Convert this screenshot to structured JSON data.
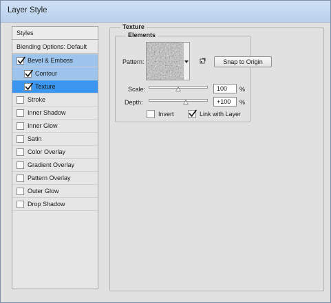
{
  "window": {
    "title": "Layer Style"
  },
  "styles_panel": {
    "header": "Styles",
    "blending_options": "Blending Options: Default",
    "items": [
      {
        "label": "Bevel & Emboss",
        "checked": true,
        "indent": false,
        "selected": "light"
      },
      {
        "label": "Contour",
        "checked": true,
        "indent": true,
        "selected": "light"
      },
      {
        "label": "Texture",
        "checked": true,
        "indent": true,
        "selected": "strong"
      },
      {
        "label": "Stroke",
        "checked": false,
        "indent": false,
        "selected": "none"
      },
      {
        "label": "Inner Shadow",
        "checked": false,
        "indent": false,
        "selected": "none"
      },
      {
        "label": "Inner Glow",
        "checked": false,
        "indent": false,
        "selected": "none"
      },
      {
        "label": "Satin",
        "checked": false,
        "indent": false,
        "selected": "none"
      },
      {
        "label": "Color Overlay",
        "checked": false,
        "indent": false,
        "selected": "none"
      },
      {
        "label": "Gradient Overlay",
        "checked": false,
        "indent": false,
        "selected": "none"
      },
      {
        "label": "Pattern Overlay",
        "checked": false,
        "indent": false,
        "selected": "none"
      },
      {
        "label": "Outer Glow",
        "checked": false,
        "indent": false,
        "selected": "none"
      },
      {
        "label": "Drop Shadow",
        "checked": false,
        "indent": false,
        "selected": "none"
      }
    ]
  },
  "texture": {
    "section_title": "Texture",
    "elements_title": "Elements",
    "pattern_label": "Pattern:",
    "snap_button": "Snap to Origin",
    "scale_label": "Scale:",
    "scale_value": "100",
    "scale_percent": 100,
    "depth_label": "Depth:",
    "depth_value": "+100",
    "depth_percent": 100,
    "percent_sign": "%",
    "invert_label": "Invert",
    "invert_checked": false,
    "link_label": "Link with Layer",
    "link_checked": true
  },
  "colors": {
    "title_bar": "#c5daf1",
    "selected_light": "#9dc4ec",
    "selected_strong": "#3b96ef"
  },
  "icons": {
    "checkmark": "checkmark-icon",
    "new_preset": "new-preset-icon",
    "dropdown": "chevron-down-icon"
  }
}
